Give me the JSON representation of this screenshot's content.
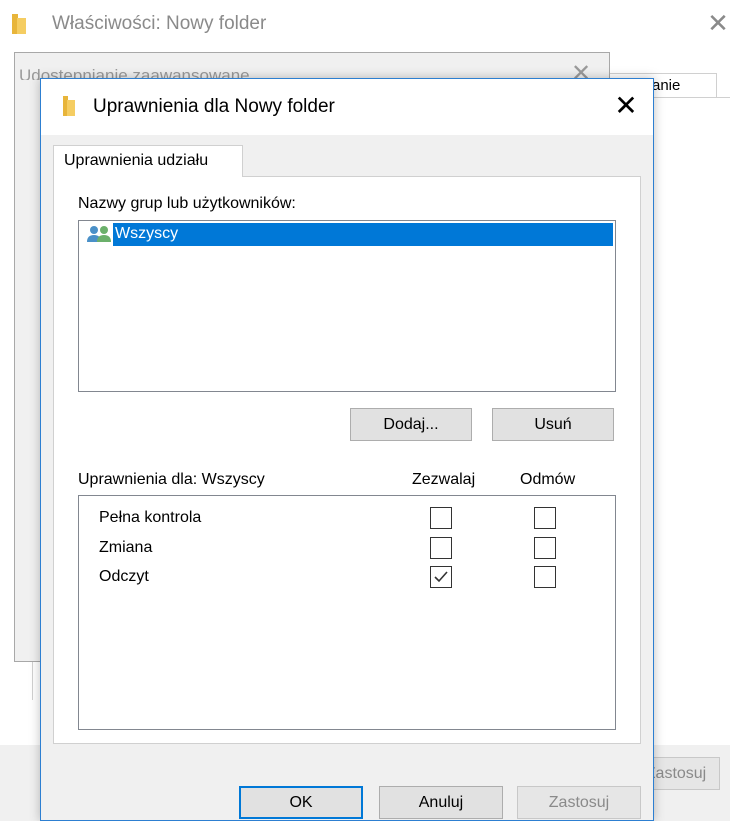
{
  "background_window": {
    "title": "Właściwości: Nowy folder",
    "close_glyph": "✕",
    "partial_tab_label": "anie",
    "apply_label": "Zastosuj"
  },
  "middle_window": {
    "title": "Udostępnianie zaawansowane",
    "close_glyph": "✕"
  },
  "dialog": {
    "title": "Uprawnienia dla Nowy folder",
    "close_glyph": "✕",
    "tab_label": "Uprawnienia udziału",
    "groups_label": "Nazwy grup lub użytkowników:",
    "users": [
      {
        "name": "Wszyscy",
        "selected": true,
        "icon": "users-group-icon"
      }
    ],
    "add_label": "Dodaj...",
    "remove_label": "Usuń",
    "permissions_for_label": "Uprawnienia dla: Wszyscy",
    "allow_label": "Zezwalaj",
    "deny_label": "Odmów",
    "permissions": [
      {
        "name": "Pełna kontrola",
        "allow": false,
        "deny": false
      },
      {
        "name": "Zmiana",
        "allow": false,
        "deny": false
      },
      {
        "name": "Odczyt",
        "allow": true,
        "deny": false
      }
    ],
    "ok_label": "OK",
    "cancel_label": "Anuluj",
    "apply_label": "Zastosuj"
  },
  "colors": {
    "selection": "#0078d7",
    "folder": "#e8b53a",
    "dialog_border": "#2d7fd1"
  }
}
